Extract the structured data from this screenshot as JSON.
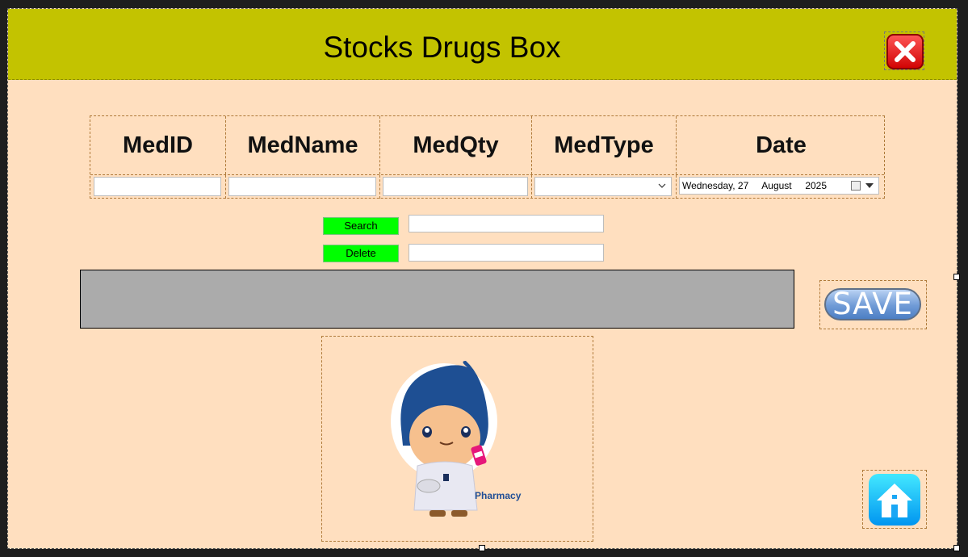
{
  "window": {
    "title": "Stocks Drugs Box"
  },
  "header": {
    "close_icon": "close-icon",
    "accent": "#c3c300"
  },
  "grid": {
    "columns": [
      "MedID",
      "MedName",
      "MedQty",
      "MedType",
      "Date"
    ],
    "fields": {
      "medid": "",
      "medname": "",
      "medqty": "",
      "medtype": "",
      "date": "Wednesday, 27     August     2025"
    }
  },
  "actions": {
    "search_label": "Search",
    "delete_label": "Delete",
    "search_value": "",
    "delete_value": "",
    "button_color": "#00ff00"
  },
  "save_label": "SAVE",
  "image": {
    "caption": "Pharmacy"
  },
  "home": {
    "icon": "home-icon"
  },
  "colors": {
    "background": "#ffdfbf",
    "grey_panel": "#ababab"
  }
}
